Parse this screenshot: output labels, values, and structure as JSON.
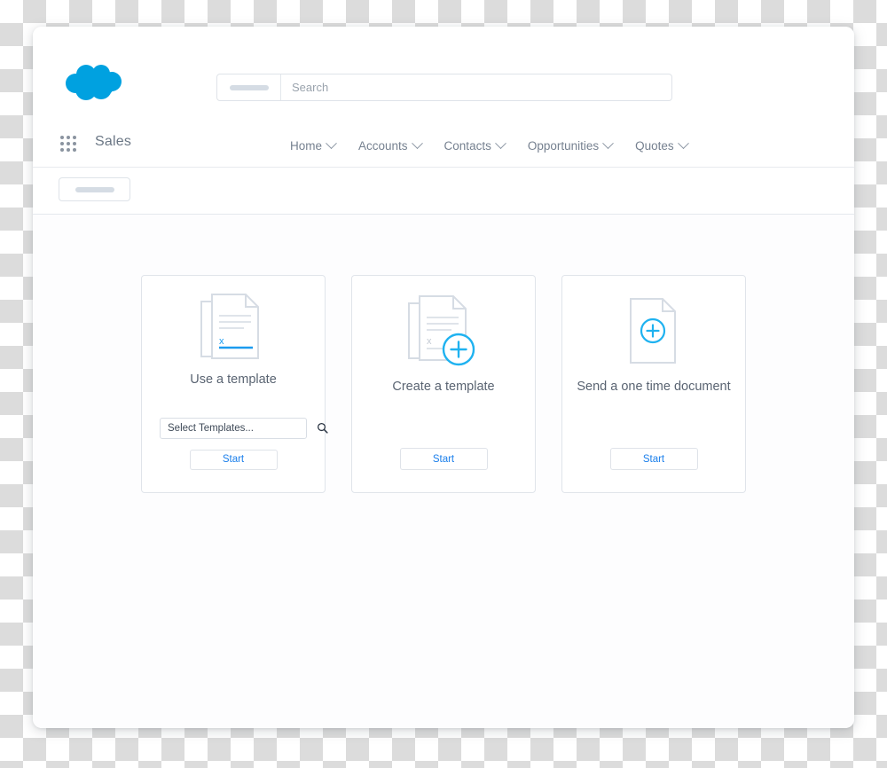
{
  "app": {
    "logo_icon": "salesforce-cloud-icon",
    "app_launcher_icon": "app-launcher-grid-icon",
    "app_name": "Sales"
  },
  "search": {
    "scope_value": "",
    "placeholder": "Search",
    "search_icon": "search-icon"
  },
  "nav": {
    "items": [
      {
        "label": "Home",
        "chevron_icon": "chevron-down-icon"
      },
      {
        "label": "Accounts",
        "chevron_icon": "chevron-down-icon"
      },
      {
        "label": "Contacts",
        "chevron_icon": "chevron-down-icon"
      },
      {
        "label": "Opportunities",
        "chevron_icon": "chevron-down-icon"
      },
      {
        "label": "Quotes",
        "chevron_icon": "chevron-down-icon"
      }
    ]
  },
  "toolbar": {
    "button_label": ""
  },
  "cards": [
    {
      "icon": "document-with-signature-icon",
      "title": "Use a template",
      "select_placeholder": "Select Templates...",
      "select_value": "",
      "select_icon": "search-icon",
      "start_label": "Start"
    },
    {
      "icon": "document-stack-add-icon",
      "title": "Create a template",
      "start_label": "Start"
    },
    {
      "icon": "blank-document-add-icon",
      "title": "Send a one time document",
      "start_label": "Start"
    }
  ],
  "colors": {
    "brand_cloud": "#00a1e0",
    "accent_blue": "#1b9bef",
    "link_blue": "#1b7feb",
    "text_gray": "#5a6472",
    "nav_gray": "#768190",
    "border_gray": "#e0e4ea"
  }
}
